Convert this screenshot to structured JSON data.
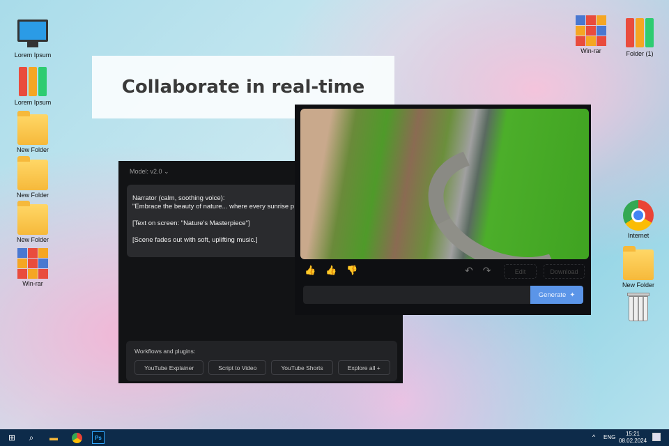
{
  "desktop": {
    "left_icons": [
      {
        "label": "Lorem Ipsum",
        "icon": "computer-icon"
      },
      {
        "label": "Lorem Ipsum",
        "icon": "binders-icon"
      },
      {
        "label": "New Folder",
        "icon": "folder-icon"
      },
      {
        "label": "New Folder",
        "icon": "folder-icon"
      },
      {
        "label": "New Folder",
        "icon": "folder-icon"
      },
      {
        "label": "Win-rar",
        "icon": "winrar-icon"
      }
    ],
    "right_icons": [
      {
        "label": "Win-rar",
        "icon": "winrar-icon"
      },
      {
        "label": "Folder (1)",
        "icon": "binders-icon"
      },
      {
        "label": "Internet",
        "icon": "chrome-icon"
      },
      {
        "label": "New Folder",
        "icon": "folder-icon"
      },
      {
        "label": "",
        "icon": "trash-icon"
      }
    ]
  },
  "headline": "Collaborate in real-time",
  "editor": {
    "model_label": "Model: v2.0",
    "text": "Narrator (calm, soothing voice):\n\"Embrace the beauty of nature... where every sunrise p\n\n[Text on screen: \"Nature's Masterpiece\"]\n\n[Scene fades out with soft, uplifting music.]"
  },
  "workflows": {
    "title": "Workflows and plugins:",
    "buttons": [
      "YouTube Explainer",
      "Script to Video",
      "YouTube Shorts",
      "Explore all +"
    ]
  },
  "preview": {
    "edit_label": "Edit",
    "download_label": "Download",
    "generate_label": "Generate",
    "accent": "#5b95e8"
  },
  "taskbar": {
    "lang": "ENG",
    "time": "15:21",
    "date": "08.02.2024"
  }
}
